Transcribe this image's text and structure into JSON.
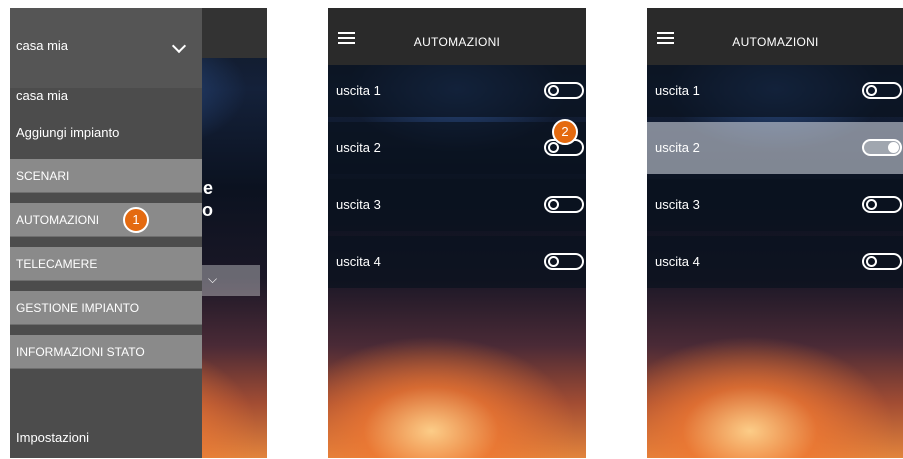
{
  "screen1": {
    "home_selector": {
      "label": "casa mia"
    },
    "home_list_item": "casa mia",
    "add_system_label": "Aggiungi impianto",
    "menu": [
      {
        "label": "SCENARI"
      },
      {
        "label": "AUTOMAZIONI",
        "badge": "1"
      },
      {
        "label": "TELECAMERE"
      },
      {
        "label": "GESTIONE IMPIANTO"
      },
      {
        "label": "INFORMAZIONI STATO"
      }
    ],
    "settings_label": "Impostazioni",
    "background_glyphs": [
      "e",
      "o"
    ]
  },
  "screen2": {
    "title": "AUTOMAZIONI",
    "badge": "2",
    "outputs": [
      {
        "label": "uscita 1",
        "on": false
      },
      {
        "label": "uscita 2",
        "on": false
      },
      {
        "label": "uscita 3",
        "on": false
      },
      {
        "label": "uscita 4",
        "on": false
      }
    ]
  },
  "screen3": {
    "title": "AUTOMAZIONI",
    "outputs": [
      {
        "label": "uscita 1",
        "on": false
      },
      {
        "label": "uscita 2",
        "on": true
      },
      {
        "label": "uscita 3",
        "on": false
      },
      {
        "label": "uscita 4",
        "on": false
      }
    ]
  },
  "colors": {
    "badge": "#e46a10",
    "menu_item_bg": "#8a8a8a",
    "drawer_bg": "#4c4c4c",
    "appbar_bg": "#2a2a2a"
  },
  "icons": [
    "hamburger-icon",
    "chevron-down-icon",
    "toggle-switch"
  ]
}
